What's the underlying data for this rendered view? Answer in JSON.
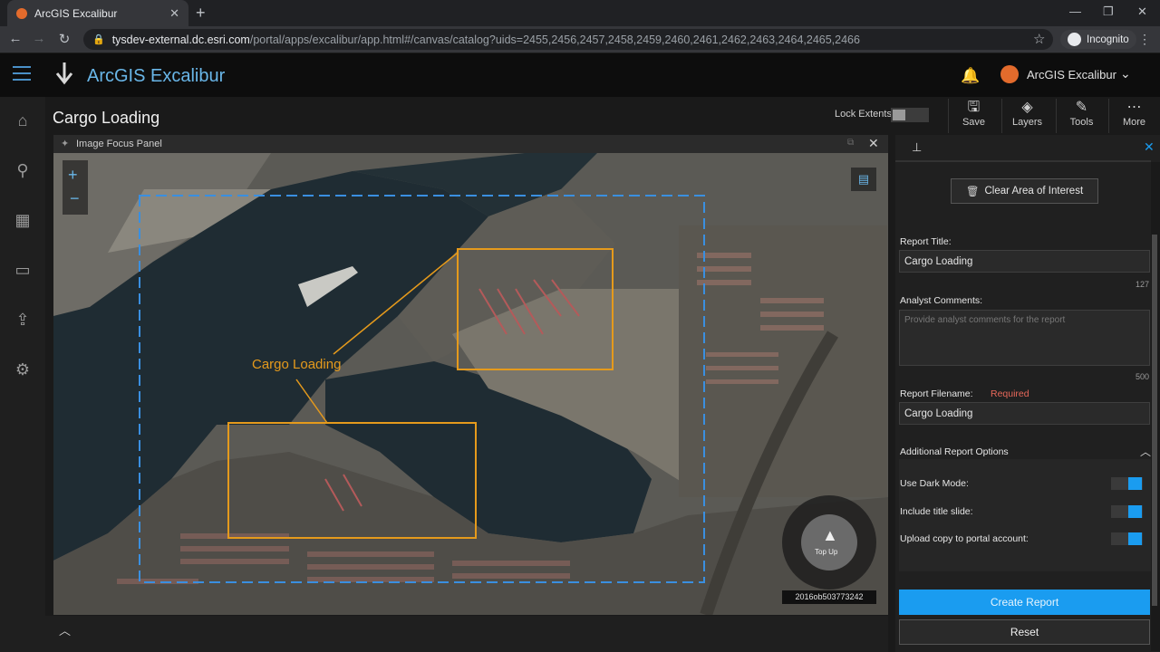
{
  "browser": {
    "tab_title": "ArcGIS Excalibur",
    "url_host": "tysdev-external.dc.esri.com",
    "url_path": "/portal/apps/excalibur/app.html#/canvas/catalog?uids=2455,2456,2457,2458,2459,2460,2461,2462,2463,2464,2465,2466",
    "incognito_label": "Incognito"
  },
  "header": {
    "app_title": "ArcGIS Excalibur",
    "user_name": "ArcGIS Excalibur"
  },
  "page": {
    "title": "Cargo Loading",
    "lock_extents_label": "Lock Extents"
  },
  "toolbar": {
    "save": "Save",
    "layers": "Layers",
    "tools": "Tools",
    "more": "More"
  },
  "panel": {
    "title": "Image Focus Panel",
    "annotation_label": "Cargo Loading",
    "compass_label": "Top Up",
    "image_id": "2016ob503773242"
  },
  "report": {
    "clear_aoi": "Clear Area of Interest",
    "title_label": "Report Title:",
    "title_value": "Cargo Loading",
    "title_count": "127",
    "comments_label": "Analyst Comments:",
    "comments_placeholder": "Provide analyst comments for the report",
    "comments_count": "500",
    "filename_label": "Report Filename:",
    "filename_required": "Required",
    "filename_value": "Cargo Loading",
    "options_label": "Additional Report Options",
    "dark_mode_label": "Use Dark Mode:",
    "title_slide_label": "Include title slide:",
    "upload_label": "Upload copy to portal account:",
    "create_button": "Create Report",
    "reset_button": "Reset"
  },
  "toggles": {
    "lock_extents": false,
    "dark_mode": true,
    "title_slide": true,
    "upload_copy": true
  },
  "colors": {
    "accent": "#1a9cf0",
    "annotation": "#e59a1c",
    "aoi_dash": "#3a8fe0",
    "required": "#e8685a",
    "brand_blue": "#69b6e8"
  }
}
